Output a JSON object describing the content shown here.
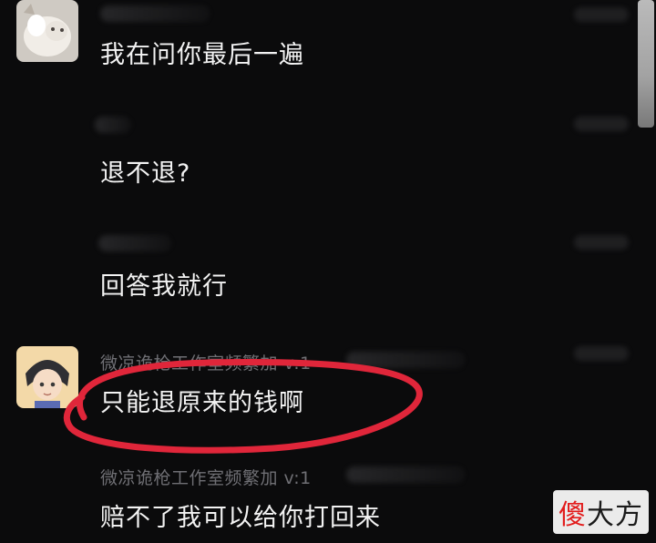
{
  "messages": [
    {
      "sender": "",
      "text": "我在问你最后一遍",
      "has_avatar": true
    },
    {
      "sender": "",
      "text": "退不退?",
      "has_avatar": false
    },
    {
      "sender": "",
      "text": "回答我就行",
      "has_avatar": false
    },
    {
      "sender": "微凉诡枪工作室频繁加 v:1",
      "text": "只能退原来的钱啊",
      "has_avatar": true
    },
    {
      "sender": "微凉诡枪工作室频繁加 v:1",
      "text": "赔不了我可以给你打回来",
      "has_avatar": false
    }
  ],
  "watermark": {
    "part_a": "傻",
    "part_b": "大方"
  },
  "colors": {
    "background": "#0b0b0c",
    "text": "#f3f3f3",
    "sender": "#6f6f74",
    "annotation": "#e0263a"
  }
}
